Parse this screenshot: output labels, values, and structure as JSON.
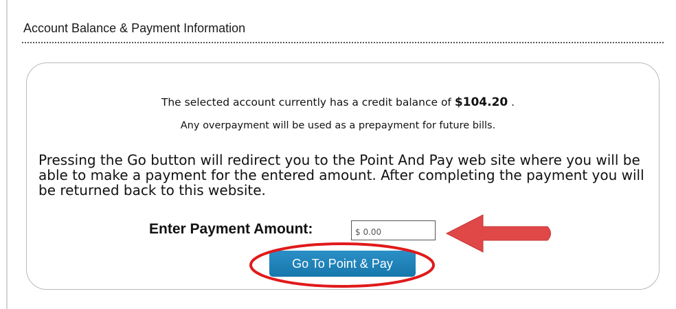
{
  "section": {
    "title": "Account Balance & Payment Information"
  },
  "balance": {
    "prefix": "The selected account currently has a credit balance of ",
    "amount": "$104.20",
    "suffix": " .",
    "note": "Any overpayment will be used as a prepayment for future bills."
  },
  "redirect_message": "Pressing the Go button will redirect you to the Point And Pay web site where you will be able to make a payment for the entered amount. After completing the payment you will be returned back to this website.",
  "payment": {
    "label": "Enter Payment Amount:",
    "placeholder": "$ 0.00",
    "value": ""
  },
  "go_button": {
    "label": "Go To Point & Pay"
  },
  "annotations": {
    "arrow_color": "#e04848",
    "circle_color": "#e01a1a"
  }
}
